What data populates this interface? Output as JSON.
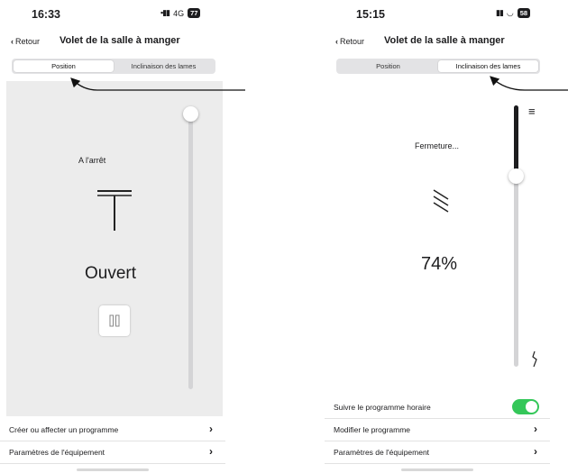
{
  "left": {
    "status": {
      "time": "16:33",
      "network": "4G",
      "battery": "77"
    },
    "nav": {
      "back": "Retour",
      "title": "Volet de la salle à manger"
    },
    "tabs": [
      {
        "label": "Position",
        "active": true
      },
      {
        "label": "Inclinaison des lames",
        "active": false
      }
    ],
    "state_text": "A l'arrêt",
    "value_text": "Ouvert",
    "slider_level": 1.0,
    "rows": [
      {
        "label": "Créer ou affecter un programme"
      },
      {
        "label": "Paramètres de l'équipement"
      }
    ]
  },
  "right": {
    "status": {
      "time": "15:15",
      "battery": "58"
    },
    "nav": {
      "back": "Retour",
      "title": "Volet de la salle à manger"
    },
    "tabs": [
      {
        "label": "Position",
        "active": false
      },
      {
        "label": "Inclinaison des lames",
        "active": true
      }
    ],
    "state_text": "Fermeture...",
    "value_text": "74%",
    "slider_level": 0.74,
    "rows": [
      {
        "label": "Suivre le programme horaire",
        "toggle": true
      },
      {
        "label": "Modifier le programme"
      },
      {
        "label": "Paramètres de l'équipement"
      }
    ]
  },
  "icons": {
    "back": "chevron-left-icon",
    "pause": "pause-icon",
    "blind_open": "blind-open-icon",
    "slats": "slats-tilt-icon",
    "menu": "hamburger-icon",
    "chevron": "chevron-right-icon"
  },
  "colors": {
    "toggle_on": "#34c759",
    "control_bg": "#ececec"
  }
}
